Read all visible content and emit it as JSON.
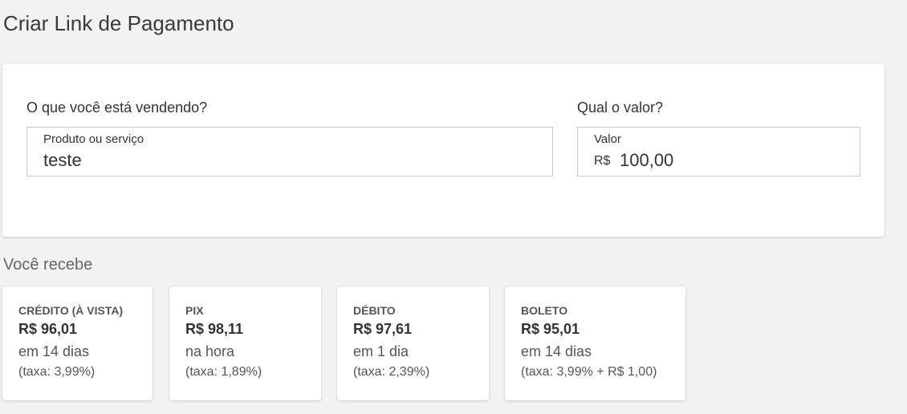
{
  "page": {
    "title": "Criar Link de Pagamento"
  },
  "form": {
    "product_question": "O que você está vendendo?",
    "product_field_label": "Produto ou serviço",
    "product_value": "teste",
    "value_question": "Qual o valor?",
    "value_field_label": "Valor",
    "currency": "R$",
    "value_amount": "100,00"
  },
  "receive": {
    "title": "Você recebe",
    "cards": [
      {
        "method": "CRÉDITO (À VISTA)",
        "amount": "R$ 96,01",
        "time": "em 14 dias",
        "fee": "(taxa: 3,99%)"
      },
      {
        "method": "PIX",
        "amount": "R$ 98,11",
        "time": "na hora",
        "fee": "(taxa: 1,89%)"
      },
      {
        "method": "DÉBITO",
        "amount": "R$ 97,61",
        "time": "em 1 dia",
        "fee": "(taxa: 2,39%)"
      },
      {
        "method": "BOLETO",
        "amount": "R$ 95,01",
        "time": "em 14 dias",
        "fee": "(taxa: 3,99% + R$ 1,00)"
      }
    ]
  }
}
